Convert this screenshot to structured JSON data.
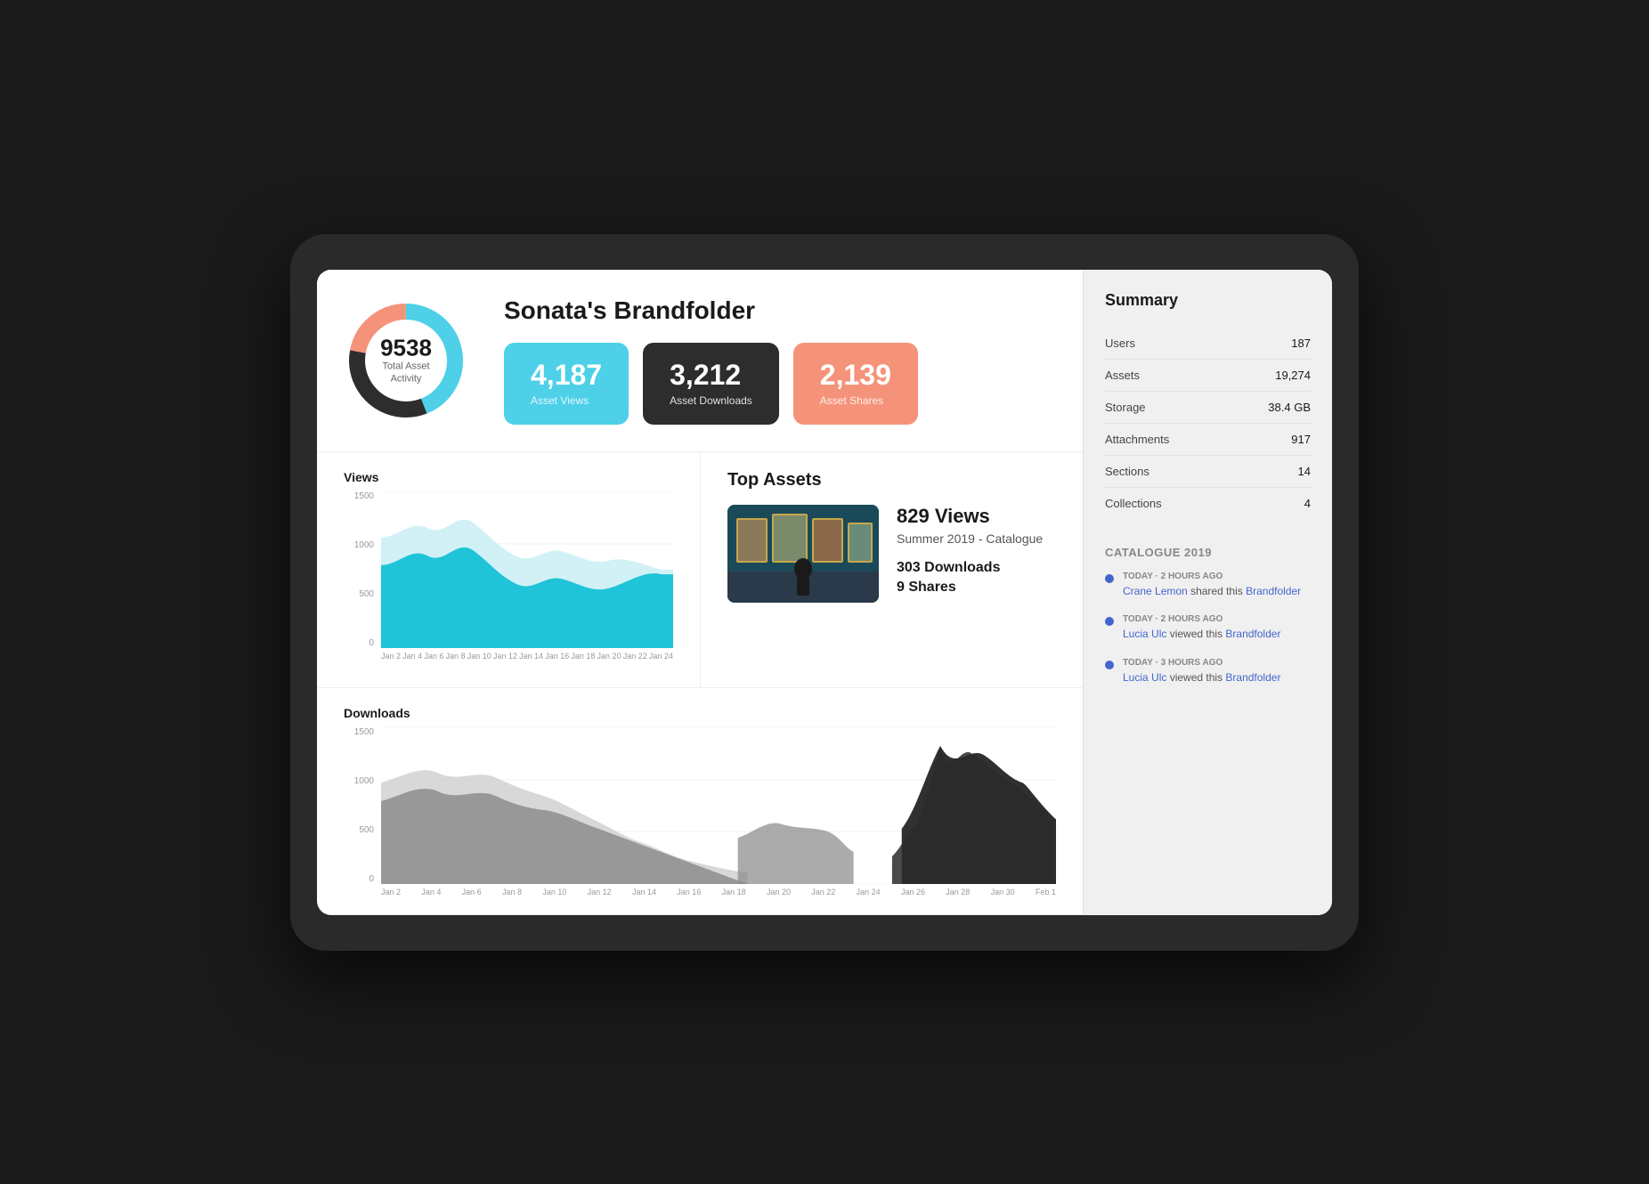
{
  "header": {
    "title": "Sonata's Brandfolder",
    "donut": {
      "number": "9538",
      "label": "Total Asset Activity"
    },
    "stats": [
      {
        "id": "views",
        "number": "4,187",
        "description": "Asset Views",
        "color": "views"
      },
      {
        "id": "downloads",
        "number": "3,212",
        "description": "Asset Downloads",
        "color": "downloads"
      },
      {
        "id": "shares",
        "number": "2,139",
        "description": "Asset Shares",
        "color": "shares"
      }
    ]
  },
  "summary": {
    "title": "Summary",
    "rows": [
      {
        "key": "Users",
        "value": "187"
      },
      {
        "key": "Assets",
        "value": "19,274"
      },
      {
        "key": "Storage",
        "value": "38.4 GB"
      },
      {
        "key": "Attachments",
        "value": "917"
      },
      {
        "key": "Sections",
        "value": "14"
      },
      {
        "key": "Collections",
        "value": "4"
      }
    ]
  },
  "activity": {
    "section_title": "Catalogue 2019",
    "items": [
      {
        "time": "TODAY · 2 HOURS AGO",
        "text_before": "",
        "person": "Crane Lemon",
        "action": " shared this ",
        "link": "Brandfolder"
      },
      {
        "time": "TODAY · 2 HOURS AGO",
        "text_before": "",
        "person": "Lucia Ulc",
        "action": " viewed this ",
        "link": "Brandfolder"
      },
      {
        "time": "TODAY · 3 HOURS AGO",
        "text_before": "",
        "person": "Lucia Ulc",
        "action": " viewed this ",
        "link": "Brandfolder"
      }
    ]
  },
  "views_chart": {
    "title": "Views",
    "y_labels": [
      "1500",
      "1000",
      "500",
      "0"
    ],
    "x_labels": [
      "Jan 2",
      "Jan 4",
      "Jan 6",
      "Jan 8",
      "Jan 10",
      "Jan 12",
      "Jan 14",
      "Jan 16",
      "Jan 18",
      "Jan 20",
      "Jan 22",
      "Jan 24"
    ]
  },
  "downloads_chart": {
    "title": "Downloads",
    "y_labels": [
      "1500",
      "1000",
      "500",
      "0"
    ],
    "x_labels": [
      "Jan 2",
      "Jan 4",
      "Jan 6",
      "Jan 8",
      "Jan 10",
      "Jan 12",
      "Jan 14",
      "Jan 16",
      "Jan 18",
      "Jan 20",
      "Jan 22",
      "Jan 24",
      "Jan 26",
      "Jan 28",
      "Jan 30",
      "Feb 1"
    ]
  },
  "top_assets": {
    "title": "Top Assets",
    "item": {
      "views": "829 Views",
      "name": "Summer 2019 - Catalogue",
      "downloads": "303 Downloads",
      "shares": "9 Shares"
    }
  }
}
